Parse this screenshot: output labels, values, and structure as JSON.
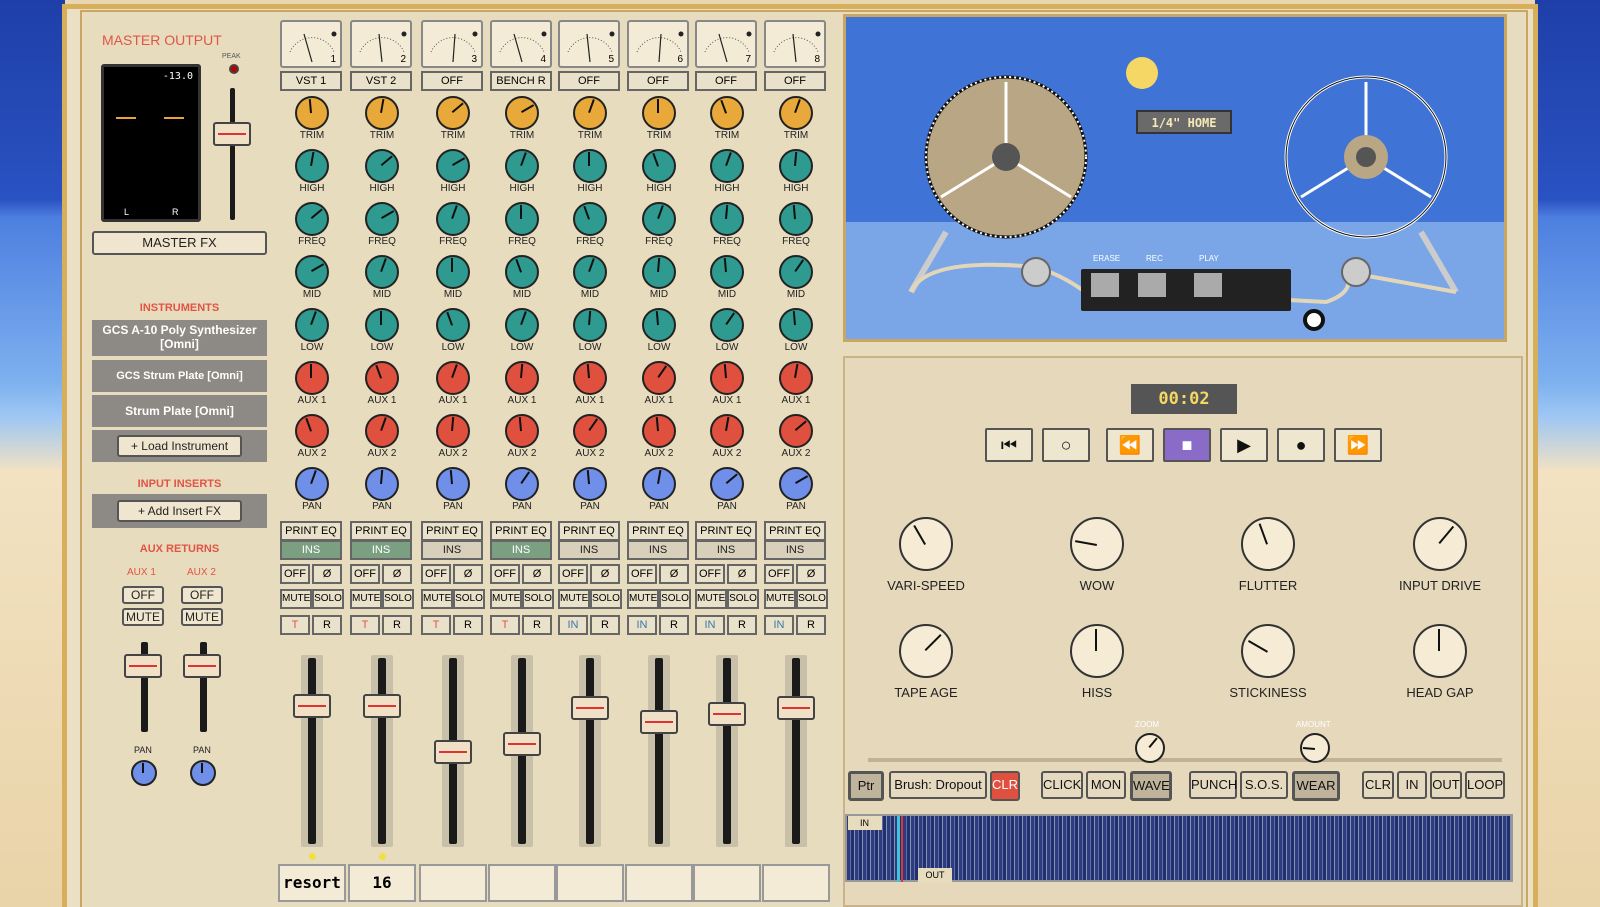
{
  "master": {
    "title": "MASTER OUTPUT",
    "peak_label": "PEAK",
    "meter_value": "-13.0",
    "meter_l": "L",
    "meter_r": "R",
    "fx_button": "MASTER FX"
  },
  "instruments": {
    "heading": "INSTRUMENTS",
    "items": [
      "GCS A-10 Poly Synthesizer [Omni]",
      "GCS Strum Plate [Omni]",
      "Strum Plate [Omni]"
    ],
    "load": "+ Load Instrument"
  },
  "inserts": {
    "heading": "INPUT INSERTS",
    "add": "+ Add Insert FX"
  },
  "aux": {
    "heading": "AUX RETURNS",
    "labels": [
      "AUX 1",
      "AUX 2"
    ],
    "off": "OFF",
    "mute": "MUTE",
    "pan": "PAN"
  },
  "channels": [
    {
      "num": "1",
      "name": "VST 1",
      "ins_on": true,
      "t": "T",
      "bottom": "resort"
    },
    {
      "num": "2",
      "name": "VST 2",
      "ins_on": true,
      "t": "T",
      "bottom": "16"
    },
    {
      "num": "3",
      "name": "OFF",
      "ins_on": false,
      "t": "T",
      "bottom": ""
    },
    {
      "num": "4",
      "name": "BENCH R",
      "ins_on": true,
      "t": "T",
      "bottom": ""
    },
    {
      "num": "5",
      "name": "OFF",
      "ins_on": false,
      "t": "IN",
      "bottom": ""
    },
    {
      "num": "6",
      "name": "OFF",
      "ins_on": false,
      "t": "IN",
      "bottom": ""
    },
    {
      "num": "7",
      "name": "OFF",
      "ins_on": false,
      "t": "IN",
      "bottom": ""
    },
    {
      "num": "8",
      "name": "OFF",
      "ins_on": false,
      "t": "IN",
      "bottom": ""
    }
  ],
  "strip_labels": {
    "trim": "TRIM",
    "high": "HIGH",
    "freq": "FREQ",
    "mid": "MID",
    "low": "LOW",
    "aux1": "AUX 1",
    "aux2": "AUX 2",
    "pan": "PAN",
    "print_eq": "PRINT EQ",
    "ins": "INS",
    "off": "OFF",
    "phase": "Ø",
    "mute": "MUTE",
    "solo": "SOLO",
    "r": "R"
  },
  "tape": {
    "reel_label": "1/4\" HOME",
    "erase": "ERASE",
    "rec": "REC",
    "play": "PLAY",
    "time": "00:02"
  },
  "transport": {
    "icons": [
      "skip-back-icon",
      "loop-circle-icon",
      "rewind-icon",
      "stop-icon",
      "play-icon",
      "record-icon",
      "fast-forward-icon"
    ],
    "glyphs": [
      "⏮",
      "○",
      "⏪",
      "■",
      "▶",
      "●",
      "⏩"
    ]
  },
  "tape_knobs": [
    "VARI-SPEED",
    "WOW",
    "FLUTTER",
    "INPUT DRIVE",
    "TAPE AGE",
    "HISS",
    "STICKINESS",
    "HEAD GAP"
  ],
  "sliders": {
    "zoom": "ZOOM",
    "amount": "AMOUNT"
  },
  "toolbar": {
    "ptr": "Ptr",
    "brush": "Brush: Dropout",
    "clr": "CLR",
    "click": "CLICK",
    "mon": "MON",
    "wave": "WAVE",
    "punch": "PUNCH",
    "sos": "S.O.S.",
    "wear": "WEAR",
    "clr2": "CLR",
    "in": "IN",
    "out": "OUT",
    "loop": "LOOP"
  },
  "timeline": {
    "in": "IN",
    "out": "OUT"
  },
  "colors": {
    "accent_red": "#e05545",
    "knob_orange": "#e9a93a",
    "knob_teal": "#2f9a8f",
    "knob_red": "#e0503f",
    "knob_blue": "#6f8fe8",
    "ins_green": "#7aa081",
    "tape_blue": "#3f74d6"
  }
}
